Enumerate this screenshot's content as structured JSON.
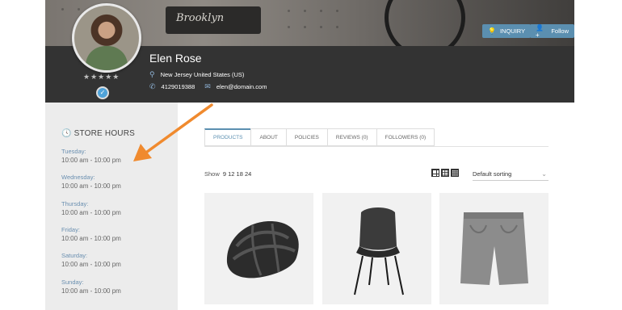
{
  "header": {
    "banner_text": "Brooklyn",
    "store_name": "Elen Rose",
    "location": "New Jersey United States (US)",
    "phone": "4129019388",
    "email": "elen@domain.com",
    "rating_stars": "★★★★★",
    "buttons": {
      "inquiry": "INQUIRY",
      "follow": "Follow"
    }
  },
  "sidebar": {
    "title": "STORE HOURS",
    "hours": [
      {
        "day": "Tuesday:",
        "time": "10:00 am - 10:00 pm"
      },
      {
        "day": "Wednesday:",
        "time": "10:00 am - 10:00 pm"
      },
      {
        "day": "Thursday:",
        "time": "10:00 am - 10:00 pm"
      },
      {
        "day": "Friday:",
        "time": "10:00 am - 10:00 pm"
      },
      {
        "day": "Saturday:",
        "time": "10:00 am - 10:00 pm"
      },
      {
        "day": "Sunday:",
        "time": "10:00 am - 10:00 pm"
      }
    ]
  },
  "tabs": [
    "PRODUCTS",
    "ABOUT",
    "POLICIES",
    "REVIEWS (0)",
    "FOLLOWERS (0)"
  ],
  "toolbar": {
    "show_label": "Show",
    "show_options": "9 12 18 24",
    "sort_value": "Default sorting"
  },
  "products": [
    {
      "icon": "bike-helmet"
    },
    {
      "icon": "wicker-chair"
    },
    {
      "icon": "grey-shorts"
    }
  ],
  "colors": {
    "accent": "#5b8fb0",
    "annotation_arrow": "#f08a2e",
    "infobar": "#333333",
    "sidebar": "#ececec"
  }
}
